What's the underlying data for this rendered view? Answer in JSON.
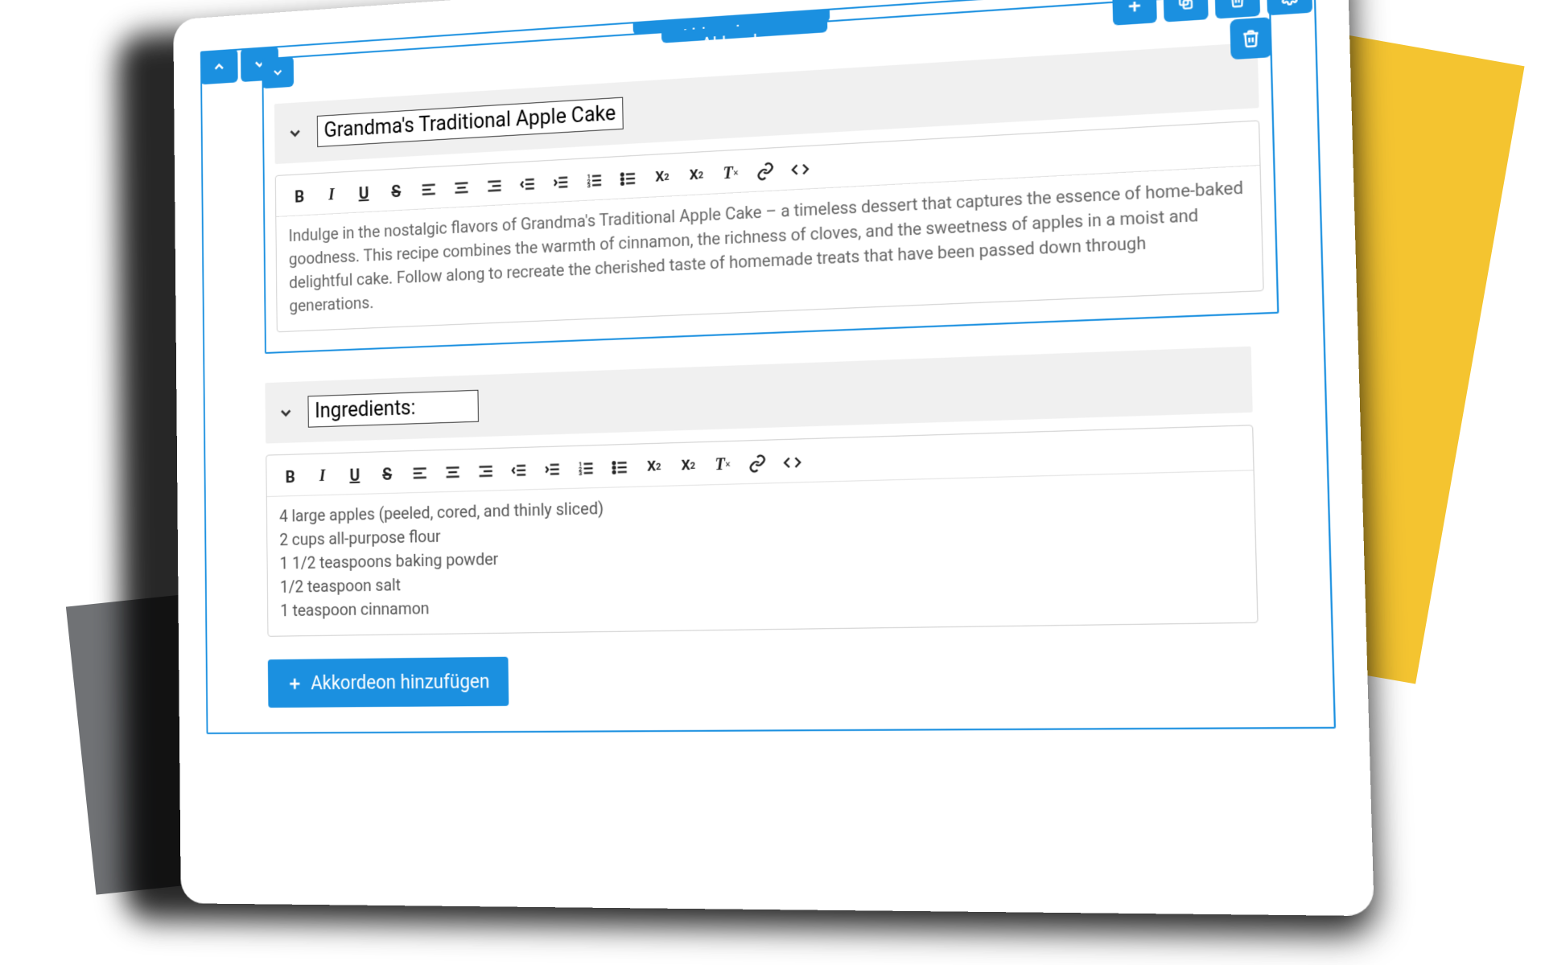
{
  "outer": {
    "label": "Akkordeons"
  },
  "inner": {
    "label": "Akkordeon"
  },
  "accordion1": {
    "title": "Grandma's Traditional Apple Cake",
    "body": "Indulge in the nostalgic flavors of Grandma's Traditional Apple Cake – a timeless dessert that captures the essence of home-baked goodness. This recipe combines the warmth of cinnamon, the richness of cloves, and the sweetness of apples in a moist and delightful cake. Follow along to recreate the cherished taste of homemade treats that have been passed down through generations."
  },
  "accordion2": {
    "title": "Ingredients:",
    "body": "4 large apples (peeled, cored, and thinly sliced)\n2 cups all-purpose flour\n1 1/2 teaspoons baking powder\n1/2 teaspoon salt\n1 teaspoon cinnamon"
  },
  "add_button": "Akkordeon hinzufügen",
  "toolbar_items": [
    "bold",
    "italic",
    "underline",
    "strike",
    "align-left",
    "align-center",
    "align-right",
    "outdent",
    "indent",
    "ordered-list",
    "unordered-list",
    "subscript",
    "superscript",
    "clear-format",
    "link",
    "code"
  ]
}
